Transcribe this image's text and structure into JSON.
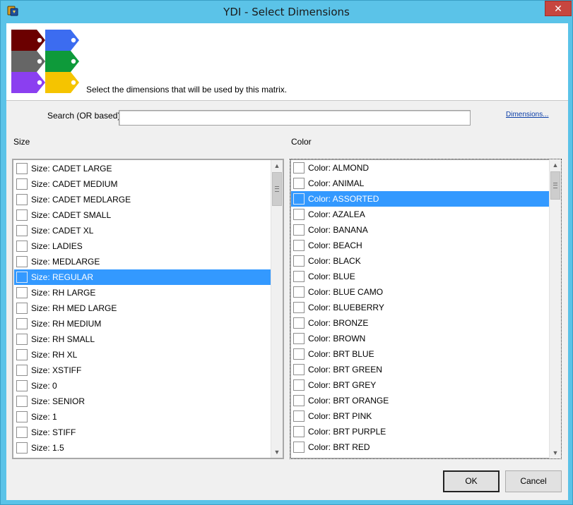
{
  "window": {
    "title": "YDI - Select Dimensions",
    "close_glyph": "✕"
  },
  "header": {
    "instruction": "Select the dimensions that will be used by this matrix."
  },
  "search": {
    "label": "Search (OR based)",
    "value": "",
    "link": "Dimensions..."
  },
  "size_list": {
    "label": "Size",
    "selected_index": 7,
    "items": [
      "Size: CADET LARGE",
      "Size: CADET MEDIUM",
      "Size: CADET MEDLARGE",
      "Size: CADET SMALL",
      "Size: CADET XL",
      "Size: LADIES",
      "Size: MEDLARGE",
      "Size: REGULAR",
      "Size: RH LARGE",
      "Size: RH MED LARGE",
      "Size: RH MEDIUM",
      "Size: RH SMALL",
      "Size: RH XL",
      "Size: XSTIFF",
      "Size: 0",
      "Size: SENIOR",
      "Size: 1",
      "Size: STIFF",
      "Size: 1.5"
    ]
  },
  "color_list": {
    "label": "Color",
    "selected_index": 2,
    "items": [
      "Color: ALMOND",
      "Color: ANIMAL",
      "Color: ASSORTED",
      "Color: AZALEA",
      "Color: BANANA",
      "Color: BEACH",
      "Color: BLACK",
      "Color: BLUE",
      "Color: BLUE CAMO",
      "Color: BLUEBERRY",
      "Color: BRONZE",
      "Color: BROWN",
      "Color: BRT BLUE",
      "Color: BRT GREEN",
      "Color: BRT GREY",
      "Color: BRT ORANGE",
      "Color: BRT PINK",
      "Color: BRT PURPLE",
      "Color: BRT RED"
    ]
  },
  "buttons": {
    "ok": "OK",
    "cancel": "Cancel"
  },
  "colors": {
    "titlebar": "#5bc3e8",
    "close": "#c7463f",
    "selection": "#3399ff",
    "tag_colors": [
      "#6b0000",
      "#3c6cf0",
      "#666666",
      "#0e9a3a",
      "#8b3ff0",
      "#f5c400"
    ]
  },
  "icons": {
    "app": "app-icon",
    "logo": "color-tags-logo-icon"
  }
}
